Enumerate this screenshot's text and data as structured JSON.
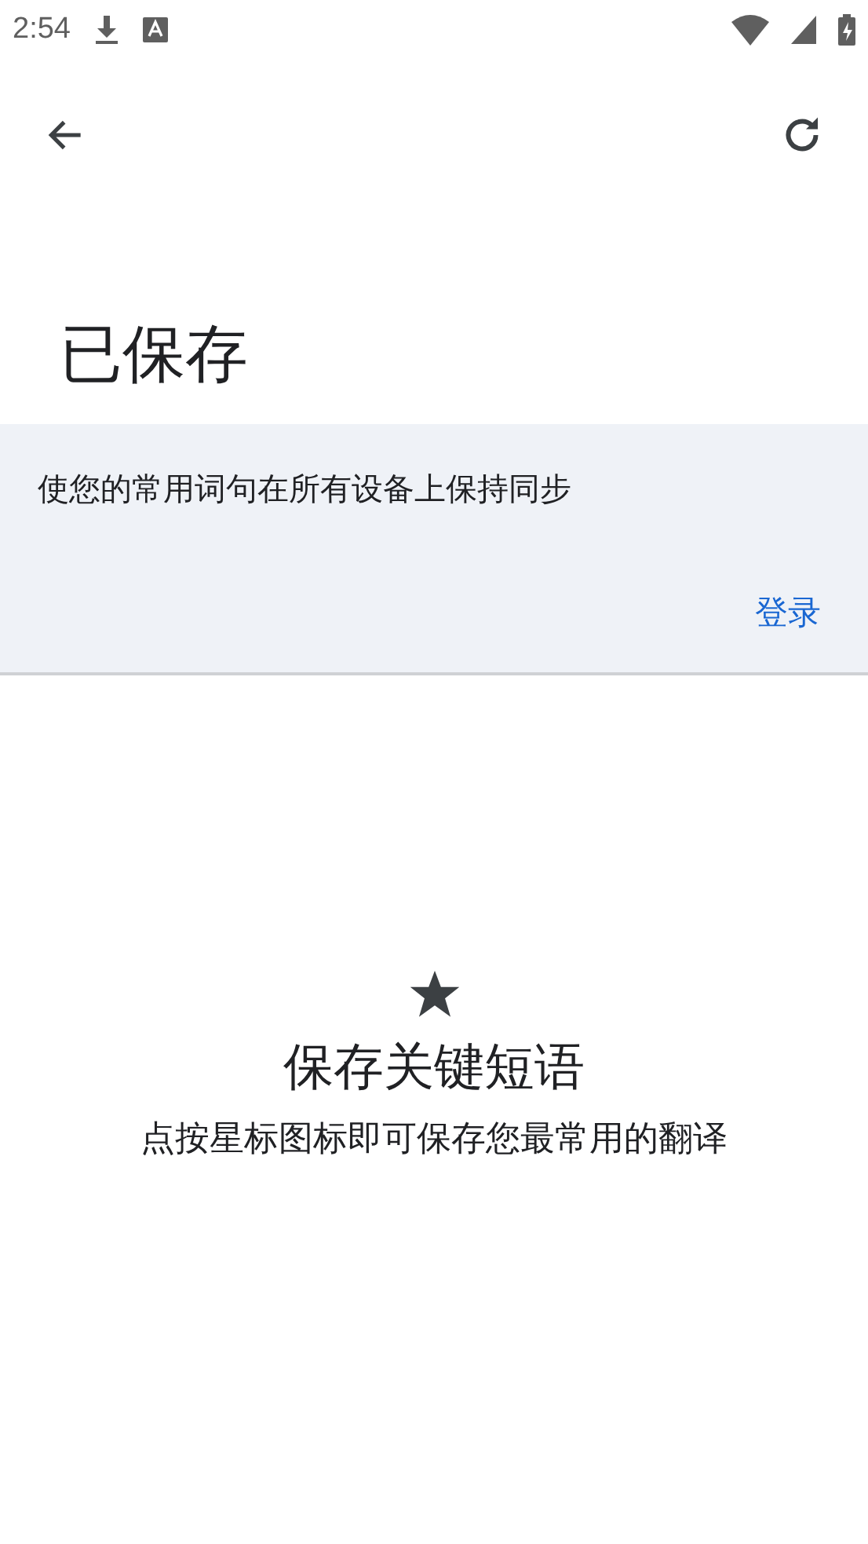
{
  "status_bar": {
    "time": "2:54"
  },
  "title": "已保存",
  "sync_banner": {
    "message": "使您的常用词句在所有设备上保持同步",
    "action": "登录"
  },
  "empty_state": {
    "title": "保存关键短语",
    "description": "点按星标图标即可保存您最常用的翻译"
  }
}
